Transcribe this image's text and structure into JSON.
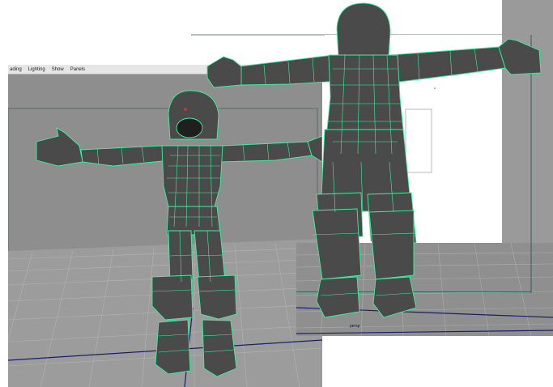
{
  "front_panel": {
    "menu": [
      "Shading",
      "Lighting",
      "Show",
      "Panels"
    ],
    "menu_display": [
      "ading",
      "Lighting",
      "Show",
      "Panels"
    ]
  },
  "back_panel": {
    "camera_label": "persp"
  },
  "colors": {
    "wireframe": "#3df0a0",
    "mesh_fill": "#4a4a4a",
    "background_gray": "#8f8f8f",
    "grid_line": "#a9a9a9",
    "axis_blue": "#1a1f6b",
    "eye_red": "#e03030"
  },
  "icons": [
    "character-mesh-front",
    "character-mesh-back",
    "ground-grid"
  ]
}
